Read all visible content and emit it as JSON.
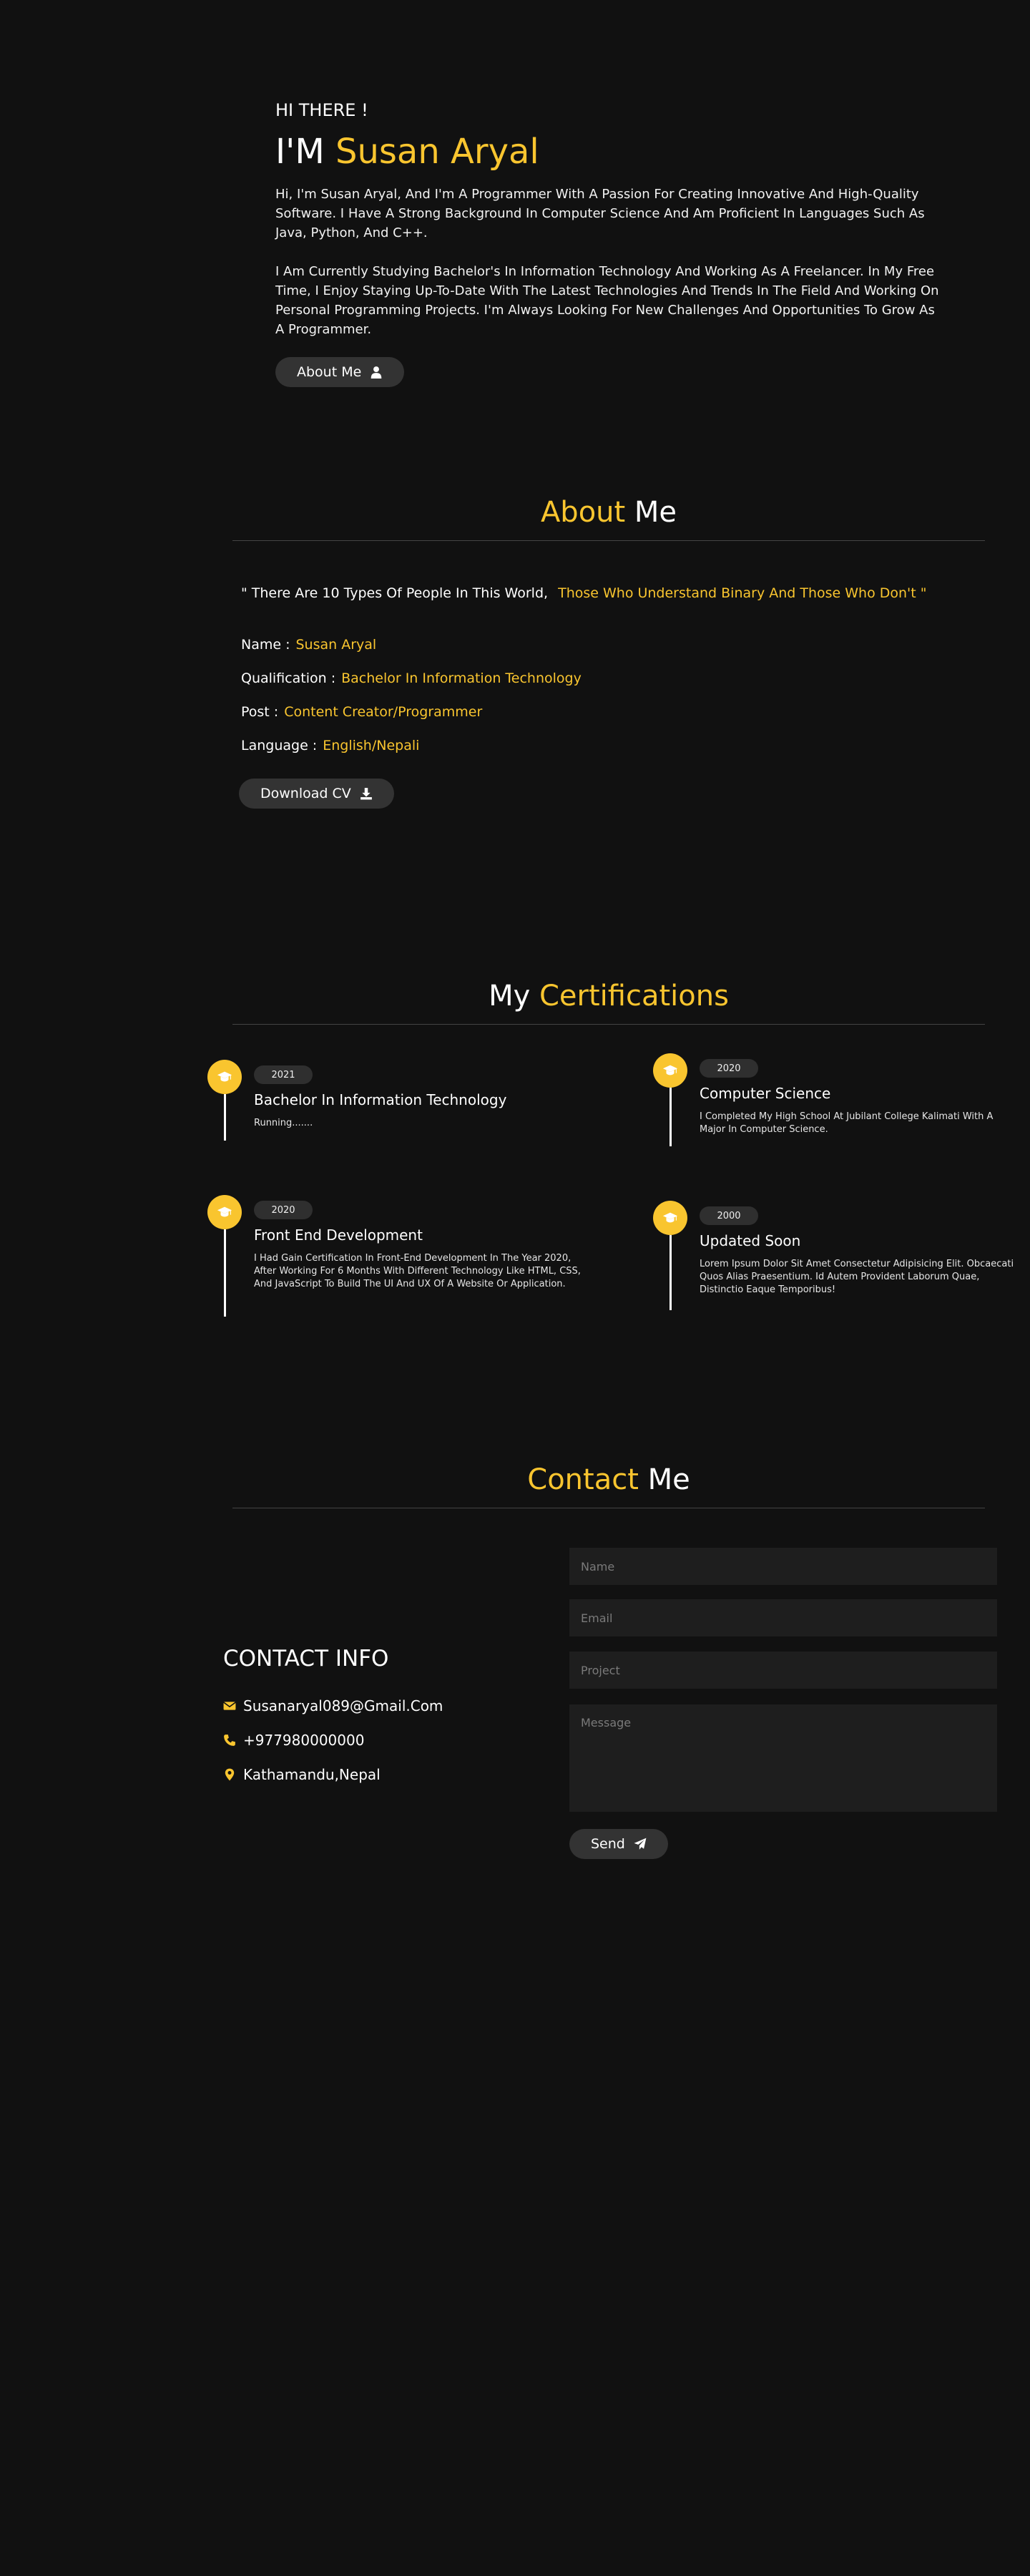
{
  "home": {
    "greeting": "HI THERE !",
    "im_prefix": "I'M",
    "name": "Susan Aryal",
    "paragraph1": "Hi, I'm Susan Aryal, And I'm A Programmer With A Passion For Creating Innovative And High-Quality Software. I Have A Strong Background In Computer Science And Am Proficient In Languages Such As Java, Python, And C++.",
    "paragraph2": "I Am Currently Studying Bachelor's In Information Technology And Working As A Freelancer. In My Free Time, I Enjoy Staying Up-To-Date With The Latest Technologies And Trends In The Field And Working On Personal Programming Projects. I'm Always Looking For New Challenges And Opportunities To Grow As A Programmer.",
    "about_button": "About Me",
    "about_button_icon": "user-icon"
  },
  "about": {
    "heading_accent": "About",
    "heading_rest": "Me",
    "quote_start": "\" There Are 10 Types Of People In This World,",
    "quote_end": "Those Who Understand Binary And Those Who Don't \"",
    "rows": [
      {
        "label": "Name :",
        "value": "Susan Aryal"
      },
      {
        "label": "Qualification :",
        "value": "Bachelor In Information Technology"
      },
      {
        "label": "Post :",
        "value": "Content Creator/Programmer"
      },
      {
        "label": "Language :",
        "value": "English/Nepali"
      }
    ],
    "download_button": "Download CV",
    "download_icon": "download-icon"
  },
  "certifications": {
    "heading_lead": "My",
    "heading_accent": "Certifications",
    "icon": "graduation-cap-icon",
    "items": [
      {
        "year": "2021",
        "title": "Bachelor In Information Technology",
        "description": "Running......."
      },
      {
        "year": "2020",
        "title": "Computer Science",
        "description": "I Completed My High School At Jubilant College Kalimati With A Major In Computer Science."
      },
      {
        "year": "2020",
        "title": "Front End Development",
        "description": "I Had Gain Certification In Front-End Development In The Year 2020, After Working For 6 Months With Different Technology Like HTML, CSS, And JavaScript To Build The UI And UX Of A Website Or Application."
      },
      {
        "year": "2000",
        "title": "Updated Soon",
        "description": "Lorem Ipsum Dolor Sit Amet Consectetur Adipisicing Elit. Obcaecati Quos Alias Praesentium. Id Autem Provident Laborum Quae, Distinctio Eaque Temporibus!"
      }
    ]
  },
  "contact": {
    "heading_accent": "Contact",
    "heading_rest": "Me",
    "info_title": "CONTACT INFO",
    "email": "Susanaryal089@Gmail.Com",
    "phone": "+977980000000",
    "location": "Kathamandu,Nepal",
    "placeholders": {
      "name": "Name",
      "email": "Email",
      "project": "Project",
      "message": "Message"
    },
    "send_button": "Send",
    "send_icon": "paper-plane-icon"
  },
  "colors": {
    "background": "#111111",
    "accent": "#f9c52f",
    "button": "#333333",
    "input": "#1e1e1e"
  }
}
